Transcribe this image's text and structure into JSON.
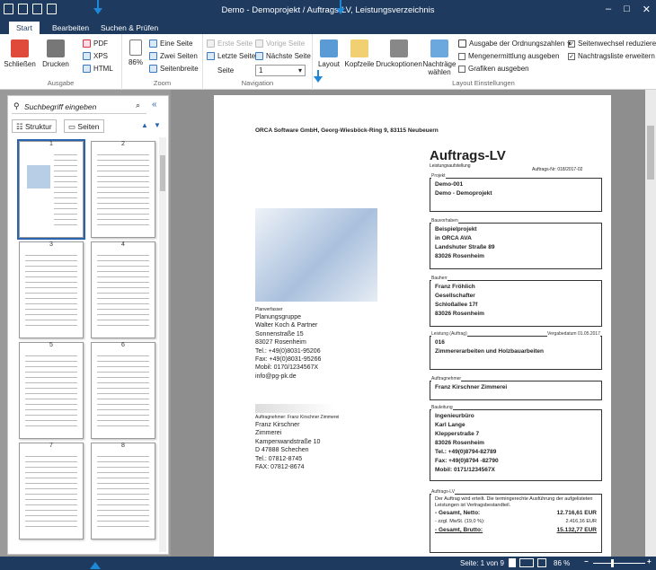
{
  "window": {
    "title": "Demo - Demoprojekt / Auftrags-LV, Leistungsverzeichnis"
  },
  "tabs": [
    "Start",
    "Bearbeiten",
    "Suchen & Prüfen"
  ],
  "ribbon": {
    "schliessen": "Schließen",
    "drucken": "Drucken",
    "pdf": "PDF",
    "xps": "XPS",
    "html": "HTML",
    "ausgabe_label": "Ausgabe",
    "zoom_value": "86%",
    "eine_seite": "Eine Seite",
    "zwei_seiten": "Zwei Seiten",
    "seitenbreite": "Seitenbreite",
    "zoom_label": "Zoom",
    "erste_seite": "Erste Seite",
    "vorige_seite": "Vorige Seite",
    "letzte_seite": "Letzte Seite",
    "naechste_seite": "Nächste Seite",
    "seite_label": "Seite",
    "seite_value": "1",
    "navigation_label": "Navigation",
    "layout": "Layout",
    "kopfzeile": "Kopfzeile",
    "druckoptionen": "Druckoptionen",
    "nachtraege": "Nachträge",
    "waehlen": "wählen",
    "ordnungszahlen": "Ausgabe der Ordnungszahlen",
    "mengenermittlung": "Mengenermittlung ausgeben",
    "grafiken": "Grafiken ausgeben",
    "seitenwechsel": "Seitenwechsel reduzieren",
    "nachtragsliste": "Nachtragsliste erweitern",
    "layout_einstellungen": "Layout Einstellungen"
  },
  "sidebar": {
    "search_placeholder": "Suchbegriff eingeben",
    "struktur": "Struktur",
    "seiten": "Seiten",
    "pages": [
      "1",
      "2",
      "3",
      "4",
      "5",
      "6",
      "7",
      "8"
    ]
  },
  "document": {
    "company": "ORCA Software GmbH, Georg-Wiesböck-Ring 9, 83115 Neubeuern",
    "title": "Auftrags-LV",
    "subtitle": "Leistungsaufstellung",
    "auftrag_nr": "Auftrags-Nr: 018/2017-02",
    "projekt_cap": "Projekt",
    "projekt": [
      "Demo-001",
      "Demo - Demoprojekt"
    ],
    "bauvorhaben_cap": "Bauvorhaben",
    "bauvorhaben": [
      "Beispielprojekt",
      "in ORCA AVA",
      "Landshuter Straße 89",
      "83026 Rosenheim"
    ],
    "bauherr_cap": "Bauherr",
    "bauherr": [
      "Franz Fröhlich",
      "Gesellschafter",
      "Schloßallee 17f",
      "83026 Rosenheim"
    ],
    "leistung_cap": "Leistung (Auftrag)",
    "leistung_date": "Vergabedatum 01.05.2017",
    "leistung": [
      "016",
      "Zimmererarbeiten und Holzbauarbeiten"
    ],
    "auftragnehmer_cap": "Auftragnehmer",
    "auftragnehmer": [
      "Franz Kirschner Zimmerei"
    ],
    "bauleitung_cap": "Bauleitung",
    "bauleitung": [
      "Ingenieurbüro",
      "Karl Lange",
      "Klepperstraße 7",
      "83026 Rosenheim",
      "Tel.: +49(0)8794-82789",
      "Fax: +49(0)8794 -82790",
      "Mobil: 0171/1234567X"
    ],
    "planer_cap": "Planverfasser",
    "planer": [
      "Planungsgruppe",
      "Walter Koch & Partner",
      "Sonnenstraße 15",
      "83027 Rosenheim",
      "Tel.: +49(0)8031-95206",
      "Fax: +49(0)8031-95266",
      "Mobil: 0170/1234567X",
      "info@pg-pk.de"
    ],
    "an_cap": "Auftragnehmer: Franz Kirschner Zimmerei",
    "an": [
      "Franz Kirschner",
      "Zimmerei",
      "Kampenwandstraße 10",
      "D 47888 Schechen",
      "Tel.: 07812-8745",
      "FAX: 07812-8674"
    ],
    "auftrag_cap": "Auftrags-LV",
    "auftrag_text": "Der Auftrag wird erteilt. Die termingerechte Ausführung der aufgelisteten Leistungen ist Vertragsbestandteil.",
    "netto_label": "Gesamt, Netto:",
    "netto": "12.716,61 EUR",
    "mwst_label": "zzgl. MwSt. (19,0 %):",
    "mwst": "2.416,16 EUR",
    "brutto_label": "Gesamt, Brutto:",
    "brutto": "15.132,77 EUR"
  },
  "status": {
    "page": "Seite: 1 von 9",
    "zoom": "86 %"
  },
  "colors": {
    "accent": "#1e3a5f",
    "highlight": "#1e88d8"
  }
}
